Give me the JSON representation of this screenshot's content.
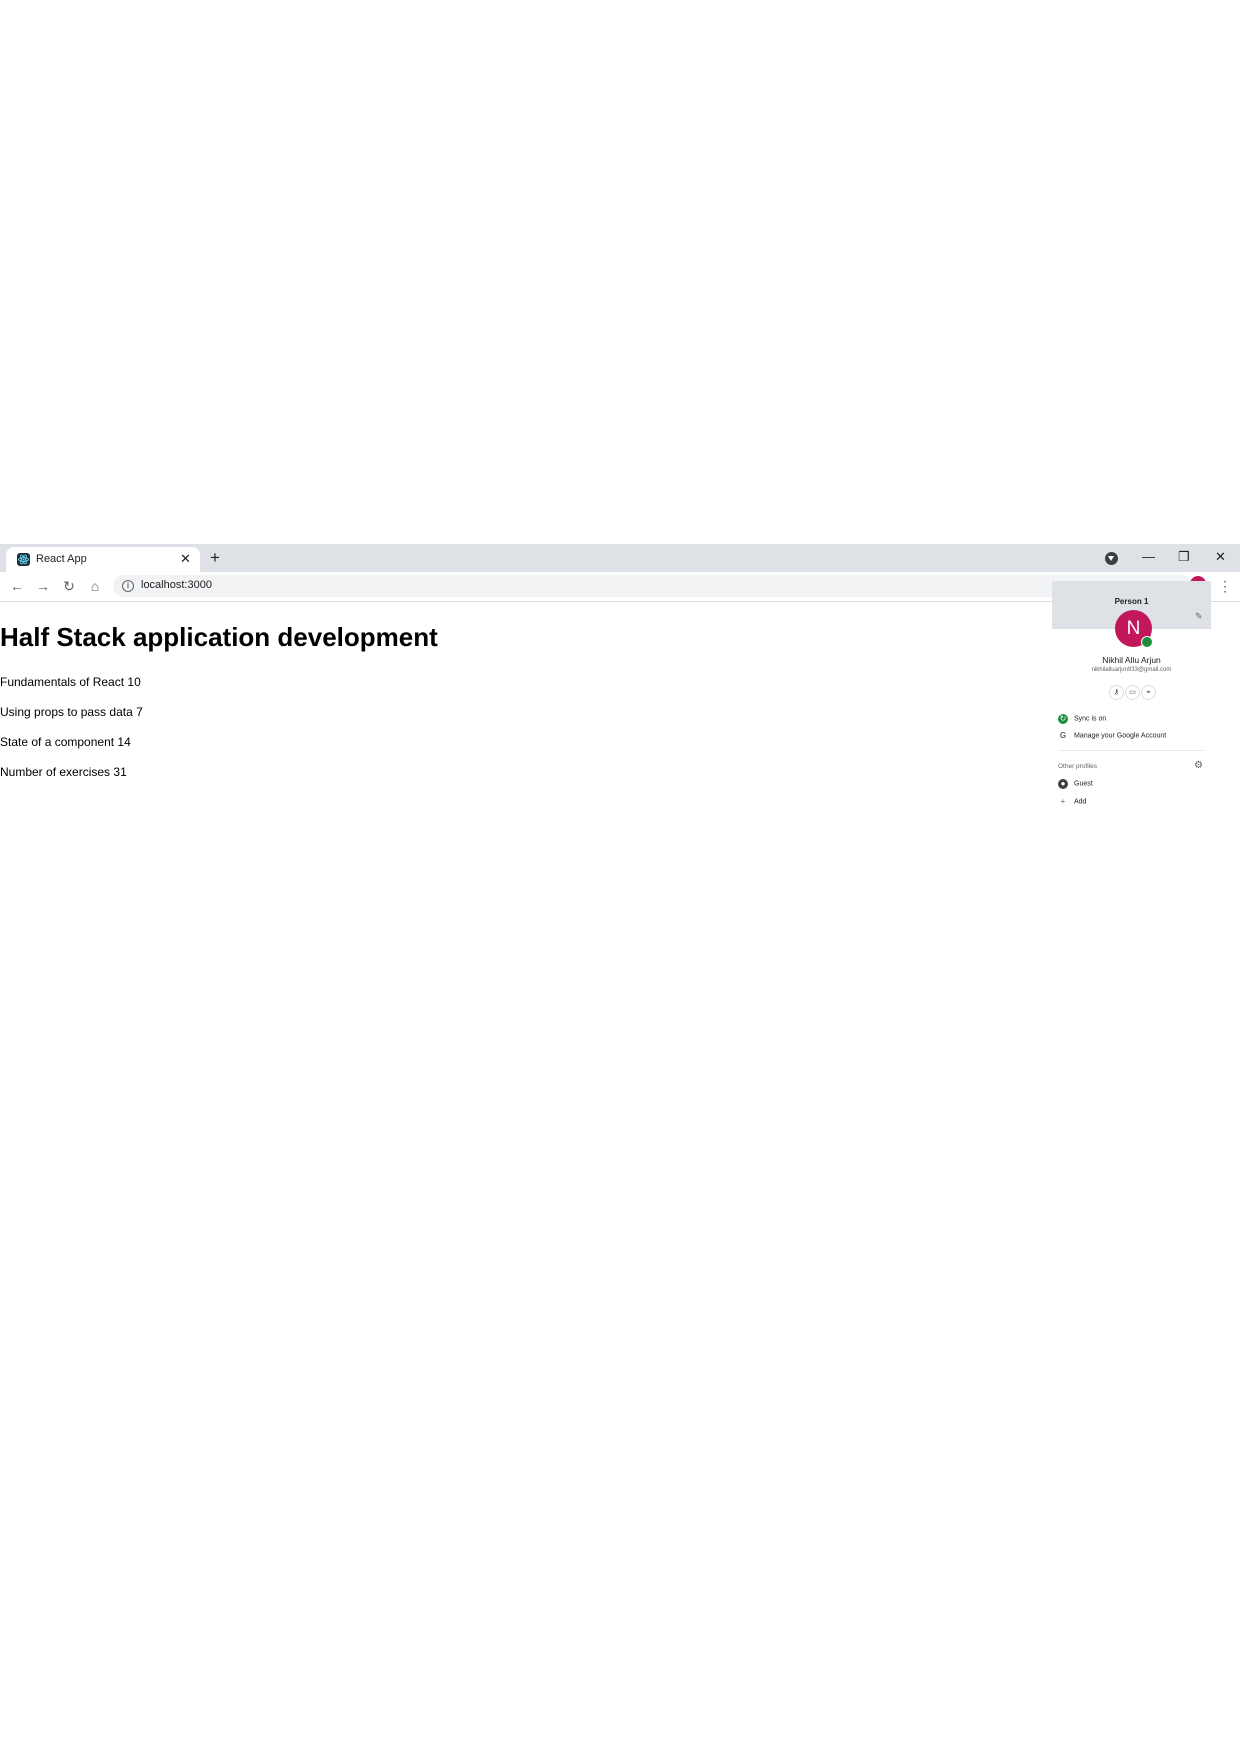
{
  "browser": {
    "tab_title": "React App",
    "tab_close": "✕",
    "new_tab": "+",
    "url": "localhost:3000",
    "window_controls": {
      "minimize": "—",
      "maximize": "❐",
      "close": "✕"
    },
    "nav": {
      "back": "←",
      "forward": "→",
      "reload": "↻",
      "home": "⌂",
      "menu": "⋮"
    },
    "icons": {
      "favicon": "react-logo-icon",
      "profile_indicator": "profile-dropdown-icon",
      "info": "info-icon"
    }
  },
  "page": {
    "header": "Half Stack application development",
    "parts": [
      {
        "name": "Fundamentals of React",
        "exercises": 10
      },
      {
        "name": "Using props to pass data",
        "exercises": 7
      },
      {
        "name": "State of a component",
        "exercises": 14
      }
    ],
    "total_label": "Number of exercises",
    "total": 31
  },
  "profile_menu": {
    "profile_name": "Person 1",
    "avatar_letter": "N",
    "avatar_color": "#c2185b",
    "full_name": "Nikhil Allu Arjun",
    "email": "nikhilalluarjun933@gmail.com",
    "sync_label": "Sync is on",
    "manage_label": "Manage your Google Account",
    "other_profiles_label": "Other profiles",
    "guest_label": "Guest",
    "add_label": "Add",
    "quick_actions": [
      "key-icon",
      "card-icon",
      "location-pin-icon"
    ]
  }
}
